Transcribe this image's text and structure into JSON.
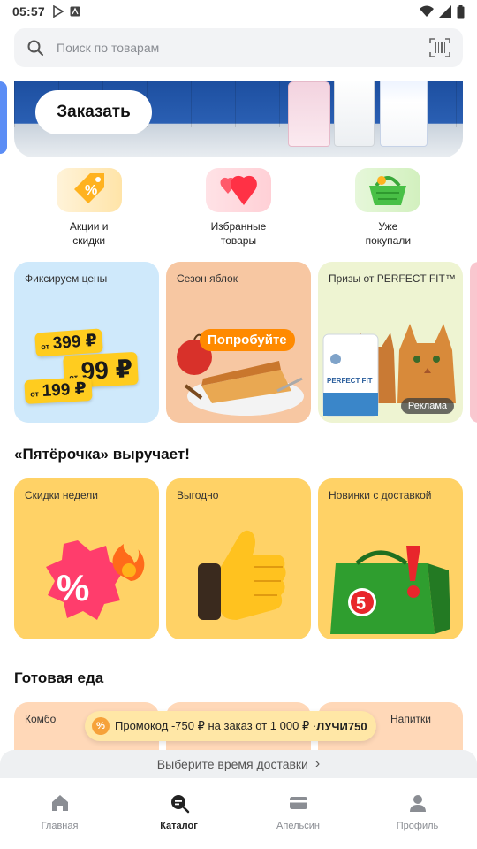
{
  "status_bar": {
    "time": "05:57"
  },
  "search": {
    "placeholder": "Поиск по товарам"
  },
  "hero": {
    "order_label": "Заказать"
  },
  "quick_categories": [
    {
      "label": "Акции и\nскидки",
      "icon": "discount-tag-icon"
    },
    {
      "label": "Избранные\nтовары",
      "icon": "hearts-icon"
    },
    {
      "label": "Уже\nпокупали",
      "icon": "basket-icon"
    }
  ],
  "promo_cards": {
    "fixed_prices": {
      "title": "Фиксируем цены",
      "tag1_prefix": "от",
      "tag1_price": "399 ₽",
      "tag2_prefix": "от",
      "tag2_price": "99 ₽",
      "tag3_prefix": "от",
      "tag3_price": "199 ₽"
    },
    "apple_season": {
      "title": "Сезон яблок",
      "badge": "Попробуйте"
    },
    "perfect_fit": {
      "title": "Призы от PERFECT FIT™",
      "pack_label": "PERFECT FIT",
      "ad_badge": "Реклама"
    }
  },
  "sections": {
    "saves_title": "«Пятёрочка» выручает!",
    "ready_food_title": "Готовая еда"
  },
  "saves_cards": [
    {
      "title": "Скидки недели"
    },
    {
      "title": "Выгодно"
    },
    {
      "title": "Новинки с доставкой"
    }
  ],
  "food_cards": [
    {
      "title": "Комбо"
    },
    {
      "title": ""
    },
    {
      "title": "Напитки"
    }
  ],
  "promo_pill": {
    "icon_text": "%",
    "text": "Промокод -750 ₽ на заказ от 1 000 ₽ · ",
    "code": "ЛУЧИ750"
  },
  "delivery": {
    "label": "Выберите время доставки",
    "chevron": "›"
  },
  "bottom_nav": [
    {
      "label": "Главная",
      "active": false
    },
    {
      "label": "Каталог",
      "active": true
    },
    {
      "label": "Апельсин",
      "active": false
    },
    {
      "label": "Профиль",
      "active": false
    }
  ],
  "colors": {
    "accent_yellow": "#ffcc1f",
    "promo_orange": "#ff8a00",
    "light_blue_card": "#cfe9fb",
    "apple_card": "#f7c7a2",
    "perfect_fit_card": "#eef4d2",
    "saves_card": "#ffd266"
  }
}
